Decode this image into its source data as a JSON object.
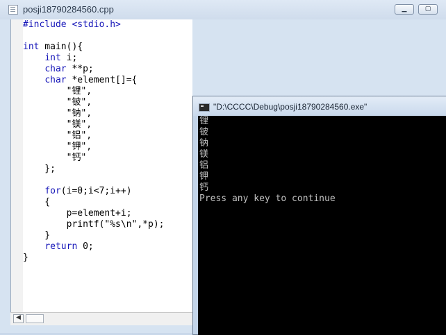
{
  "editor": {
    "title": "posji18790284560.cpp",
    "code_lines": [
      [
        {
          "t": "#include <stdio.h>",
          "k": "kw"
        }
      ],
      [],
      [
        {
          "t": "int",
          "k": "kw"
        },
        {
          "t": " main(){"
        }
      ],
      [
        {
          "t": "    "
        },
        {
          "t": "int",
          "k": "kw"
        },
        {
          "t": " i;"
        }
      ],
      [
        {
          "t": "    "
        },
        {
          "t": "char",
          "k": "kw"
        },
        {
          "t": " **p;"
        }
      ],
      [
        {
          "t": "    "
        },
        {
          "t": "char",
          "k": "kw"
        },
        {
          "t": " *element[]={"
        }
      ],
      [
        {
          "t": "        \"锂\","
        }
      ],
      [
        {
          "t": "        \"铍\","
        }
      ],
      [
        {
          "t": "        \"钠\","
        }
      ],
      [
        {
          "t": "        \"镁\","
        }
      ],
      [
        {
          "t": "        \"铝\","
        }
      ],
      [
        {
          "t": "        \"钾\","
        }
      ],
      [
        {
          "t": "        \"钙\""
        }
      ],
      [
        {
          "t": "    };"
        }
      ],
      [],
      [
        {
          "t": "    "
        },
        {
          "t": "for",
          "k": "kw"
        },
        {
          "t": "(i=0;i<7;i++)"
        }
      ],
      [
        {
          "t": "    {"
        }
      ],
      [
        {
          "t": "        p=element+i;"
        }
      ],
      [
        {
          "t": "        printf(\"%s\\n\",*p);"
        }
      ],
      [
        {
          "t": "    }"
        }
      ],
      [
        {
          "t": "    "
        },
        {
          "t": "return",
          "k": "kw"
        },
        {
          "t": " 0;"
        }
      ],
      [
        {
          "t": "}"
        }
      ]
    ]
  },
  "console": {
    "title": "\"D:\\CCCC\\Debug\\posji18790284560.exe\"",
    "output": [
      "锂",
      "铍",
      "钠",
      "镁",
      "铝",
      "钾",
      "钙",
      "Press any key to continue"
    ]
  },
  "icons": {
    "minimize": "minimize-icon",
    "maximize": "maximize-icon",
    "scroll_left": "chevron-left-icon"
  },
  "colors": {
    "keyword": "#1414b8",
    "console_bg": "#000000",
    "console_text": "#c0c0c0"
  }
}
